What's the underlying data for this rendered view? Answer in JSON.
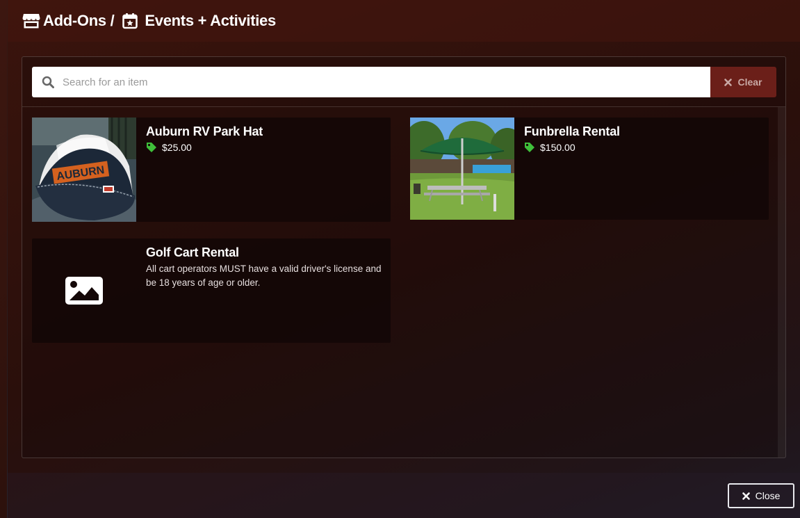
{
  "modal": {
    "title_part1": "Add-Ons /",
    "title_part2": "Events + Activities",
    "title_icon1": "store-icon",
    "title_icon2": "calendar-star-icon"
  },
  "search": {
    "placeholder": "Search for an item",
    "value": "",
    "clear_label": "Clear"
  },
  "items": [
    {
      "name": "Auburn RV Park Hat",
      "price": "$25.00",
      "image": "photo-of-navy-and-white-cap-with-orange-AUBURN-logo"
    },
    {
      "name": "Funbrella Rental",
      "price": "$150.00",
      "image": "photo-of-green-umbrella-on-lawn-near-pool"
    },
    {
      "name": "Golf Cart Rental",
      "description": "All cart operators MUST have a valid driver's license and be 18 years of age or older.",
      "image": "image-placeholder-icon"
    }
  ],
  "footer": {
    "close_label": "Close"
  },
  "colors": {
    "price_tag": "#3fbf3a",
    "clear_button_bg": "#6b1f19",
    "card_bg": "#140808"
  }
}
